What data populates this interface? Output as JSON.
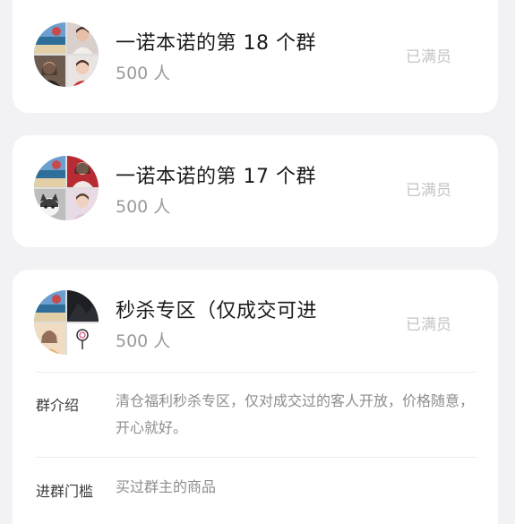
{
  "groups": [
    {
      "title": "一诺本诺的第 18 个群",
      "member_count": "500 人",
      "status": "已满员",
      "avatar_tiles": [
        "beach-photo",
        "woman-portrait",
        "woman-portrait",
        "woman-portrait"
      ]
    },
    {
      "title": "一诺本诺的第 17 个群",
      "member_count": "500 人",
      "status": "已满员",
      "avatar_tiles": [
        "beach-photo",
        "woman-portrait",
        "cat-photo",
        "woman-portrait"
      ]
    },
    {
      "title": "秒杀专区（仅成交可进",
      "member_count": "500 人",
      "status": "已满员",
      "avatar_tiles": [
        "beach-photo",
        "dark-avatar",
        "woman-portrait",
        "lollipop-icon"
      ],
      "details": {
        "intro_label": "群介绍",
        "intro_value": "清仓福利秒杀专区，仅对成交过的客人开放，价格随意，开心就好。",
        "threshold_label": "进群门槛",
        "threshold_value": "买过群主的商品"
      }
    }
  ],
  "colors": {
    "background": "#f2f2f4",
    "card": "#ffffff",
    "title": "#1b1b1b",
    "muted": "#9a9a9a",
    "status": "#c4c4c4"
  }
}
